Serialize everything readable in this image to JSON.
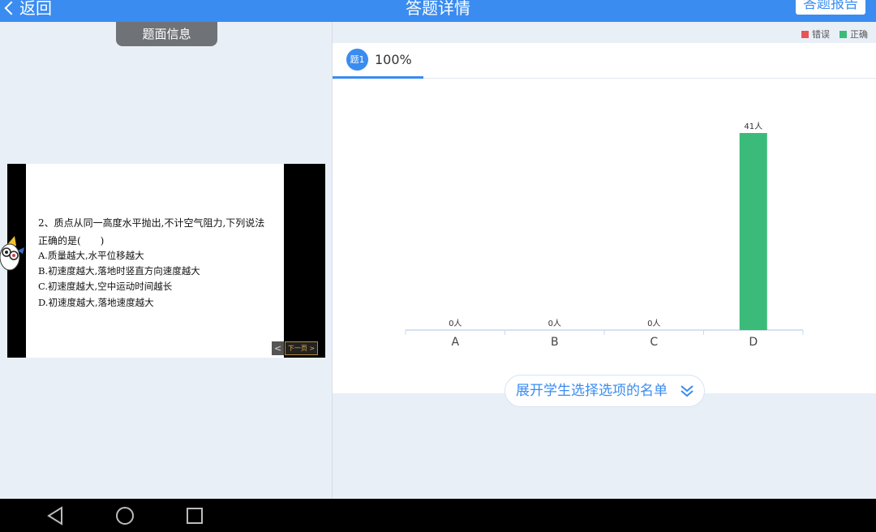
{
  "header": {
    "back_label": "返回",
    "title": "答题详情",
    "report_button": "答题报告"
  },
  "left_panel": {
    "info_tab": "题面信息",
    "question": {
      "stem": "2、质点从同一高度水平抛出,不计空气阻力,下列说法正确的是(　　)",
      "options": [
        "A.质量越大,水平位移越大",
        "B.初速度越大,落地时竖直方向速度越大",
        "C.初速度越大,空中运动时间越长",
        "D.初速度越大,落地速度越大"
      ]
    },
    "slide_prev": "<",
    "slide_next": "下一页 >"
  },
  "right_panel": {
    "legend": [
      {
        "label": "错误",
        "color": "#e85454"
      },
      {
        "label": "正确",
        "color": "#3bbb79"
      }
    ],
    "tab": {
      "badge": "题1",
      "percent": "100%"
    },
    "expand_button": "展开学生选择选项的名单"
  },
  "chart_data": {
    "type": "bar",
    "categories": [
      "A",
      "B",
      "C",
      "D"
    ],
    "values": [
      0,
      0,
      0,
      41
    ],
    "value_labels": [
      "0人",
      "0人",
      "0人",
      "41人"
    ],
    "correct": [
      false,
      false,
      false,
      true
    ],
    "colors": {
      "correct": "#3bbb79",
      "wrong": "#e85454",
      "axis": "#c9d8ec"
    },
    "ylim": [
      0,
      41
    ]
  },
  "nav": {
    "icons": [
      "back-triangle-icon",
      "home-circle-icon",
      "recents-square-icon"
    ]
  }
}
